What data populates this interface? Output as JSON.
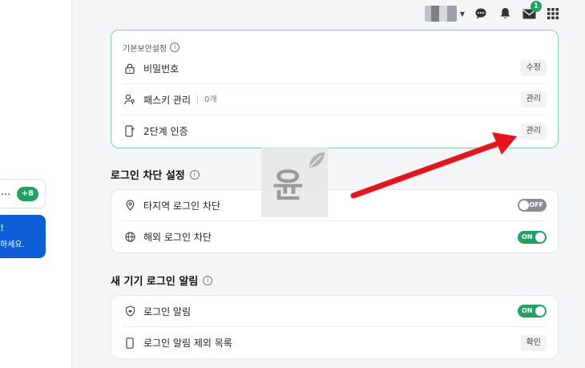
{
  "sidebar": {
    "card_text": "...",
    "card_badge": "+8",
    "notice_mark": "!",
    "notice_text": "하세요."
  },
  "header": {
    "mail_badge": "1"
  },
  "basic_security": {
    "heading": "기본보안설정",
    "rows": [
      {
        "label": "비밀번호",
        "sub": "",
        "action": "수정"
      },
      {
        "label": "패스키 관리",
        "sub": "0개",
        "action": "관리"
      },
      {
        "label": "2단계 인증",
        "sub": "",
        "action": "관리"
      }
    ]
  },
  "login_block": {
    "title": "로그인 차단 설정",
    "rows": [
      {
        "label": "타지역 로그인 차단",
        "toggle": "OFF"
      },
      {
        "label": "해외 로그인 차단",
        "toggle": "ON"
      }
    ]
  },
  "new_device": {
    "title": "새 기기 로그인 알림",
    "rows": [
      {
        "label": "로그인 알림",
        "toggle": "ON"
      },
      {
        "label": "로그인 알림 제외 목록",
        "action": "확인"
      }
    ]
  },
  "watermark": {
    "char": "윤"
  },
  "colors": {
    "accent_green": "#1ea362",
    "annotation_red": "#e8141c",
    "card_border_green": "#7fd6a4"
  }
}
